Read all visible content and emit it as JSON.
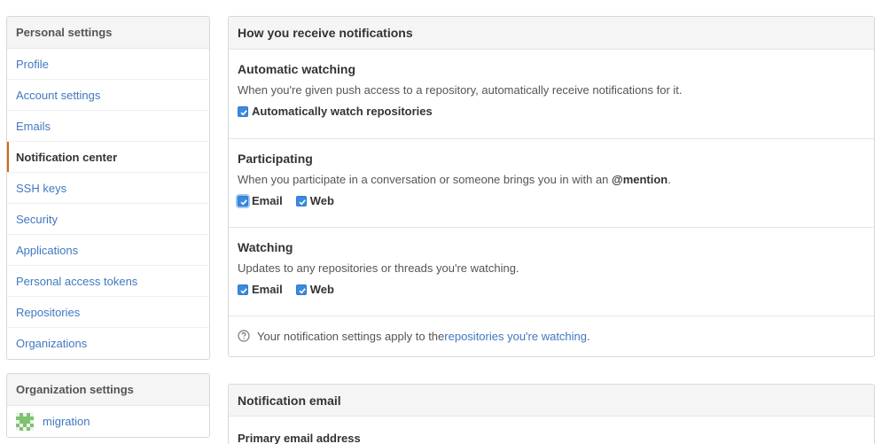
{
  "sidebar": {
    "heading": "Personal settings",
    "items": [
      {
        "label": "Profile"
      },
      {
        "label": "Account settings"
      },
      {
        "label": "Emails"
      },
      {
        "label": "Notification center"
      },
      {
        "label": "SSH keys"
      },
      {
        "label": "Security"
      },
      {
        "label": "Applications"
      },
      {
        "label": "Personal access tokens"
      },
      {
        "label": "Repositories"
      },
      {
        "label": "Organizations"
      }
    ],
    "selected": "Notification center"
  },
  "org_menu": {
    "heading": "Organization settings",
    "items": [
      {
        "label": "migration",
        "avatar": "identicon-icon"
      }
    ]
  },
  "notifications": {
    "title": "How you receive notifications",
    "automatic": {
      "heading": "Automatic watching",
      "description": "When you're given push access to a repository, automatically receive notifications for it.",
      "checkbox_label": "Automatically watch repositories",
      "checked": true
    },
    "participating": {
      "heading": "Participating",
      "description_before": "When you participate in a conversation or someone brings you in with an ",
      "mention": "@mention",
      "description_after": ".",
      "email_label": "Email",
      "email_checked": true,
      "web_label": "Web",
      "web_checked": true
    },
    "watching": {
      "heading": "Watching",
      "description": "Updates to any repositories or threads you're watching.",
      "email_label": "Email",
      "email_checked": true,
      "web_label": "Web",
      "web_checked": true
    },
    "footnote_text": "Your notification settings apply to the ",
    "footnote_link": "repositories you're watching",
    "footnote_end": "."
  },
  "notification_email": {
    "title": "Notification email",
    "primary_label": "Primary email address"
  },
  "colors": {
    "link": "#4078c0",
    "accent_selected": "#d26911",
    "checkbox": "#3a8be0"
  }
}
